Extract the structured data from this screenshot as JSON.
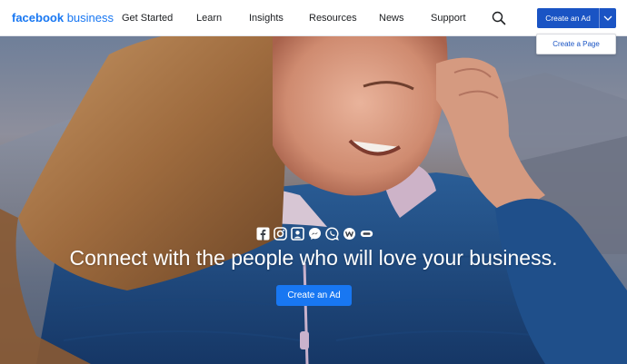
{
  "nav": {
    "logo_bold": "facebook",
    "logo_light": "business",
    "links": [
      "Get Started",
      "Learn",
      "Insights",
      "Resources",
      "News",
      "Support"
    ],
    "search_icon": "search-icon",
    "create_ad_label": "Create an Ad",
    "dropdown_icon": "chevron-down-icon",
    "dropdown_items": [
      "Create a Page"
    ]
  },
  "hero": {
    "app_icons": [
      "facebook-icon",
      "instagram-icon",
      "portal-icon",
      "messenger-icon",
      "whatsapp-icon",
      "workplace-icon",
      "oculus-icon"
    ],
    "tagline": "Connect with the people who will love your business.",
    "cta_label": "Create an Ad"
  },
  "colors": {
    "brand_blue": "#1877f2",
    "nav_cta_blue": "#1a54c4",
    "nav_text": "#1c1e21"
  }
}
